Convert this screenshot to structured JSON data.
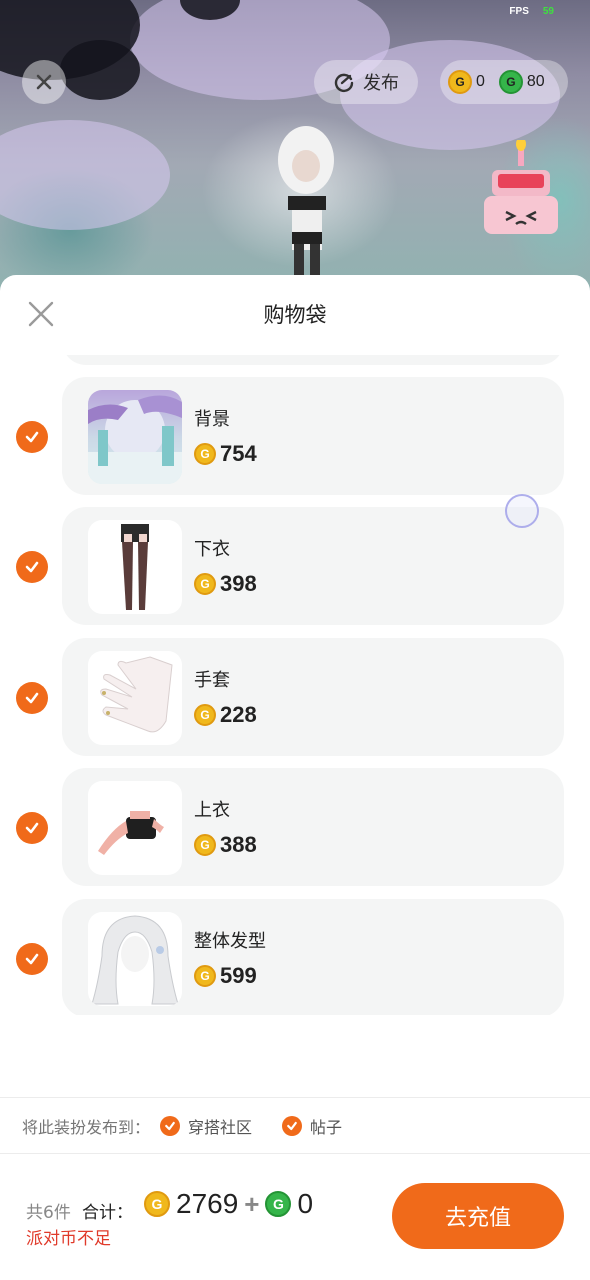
{
  "status": {
    "fps_label": "FPS",
    "fps_value": "59"
  },
  "top_bar": {
    "publish_label": "发布",
    "gold_coin_balance": "0",
    "green_coin_balance": "80",
    "coin_glyph": "G"
  },
  "sheet": {
    "title": "购物袋",
    "items": [
      {
        "name": "背景",
        "price": "754",
        "checked": true,
        "thumb_icon": "background-scene-thumbnail"
      },
      {
        "name": "下衣",
        "price": "398",
        "checked": true,
        "thumb_icon": "stockings-thumbnail"
      },
      {
        "name": "手套",
        "price": "228",
        "checked": true,
        "thumb_icon": "glove-thumbnail"
      },
      {
        "name": "上衣",
        "price": "388",
        "checked": true,
        "thumb_icon": "top-thumbnail"
      },
      {
        "name": "整体发型",
        "price": "599",
        "checked": true,
        "thumb_icon": "hairstyle-thumbnail"
      }
    ]
  },
  "publish_options": {
    "label": "将此装扮发布到：",
    "options": [
      {
        "label": "穿搭社区",
        "checked": true
      },
      {
        "label": "帖子",
        "checked": true
      }
    ]
  },
  "footer": {
    "count_text": "共6件",
    "total_label": "合计：",
    "gold_total": "2769",
    "plus": "+",
    "green_total": "0",
    "insufficient_text": "派对币不足",
    "recharge_label": "去充值"
  },
  "colors": {
    "accent": "#f06a1a",
    "gold": "#f0b81c",
    "green": "#35b54a",
    "warning": "#e03a2a"
  }
}
